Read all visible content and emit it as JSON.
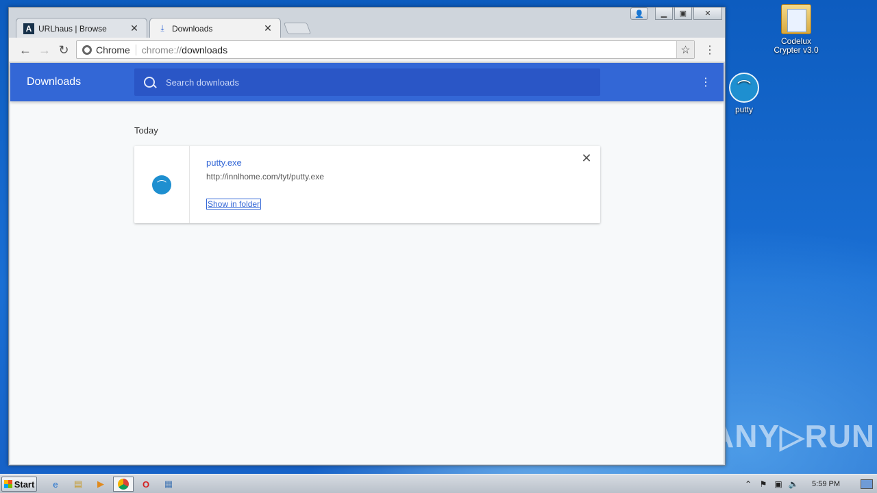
{
  "desktop": {
    "icons": [
      {
        "label": "Codelux\nCrypter v3.0",
        "glyph": "folder-icon"
      },
      {
        "label": "putty",
        "glyph": "putty-icon"
      }
    ],
    "watermark": "ANY▷RUN"
  },
  "browser": {
    "tabs": [
      {
        "title": "URLhaus | Browse",
        "favicon": "A",
        "active": false
      },
      {
        "title": "Downloads",
        "favicon": "⤓",
        "active": true
      }
    ],
    "omnibox": {
      "scheme_label": "Chrome",
      "url_prefix": "chrome://",
      "url_host": "downloads"
    }
  },
  "downloads_page": {
    "title": "Downloads",
    "search_placeholder": "Search downloads",
    "section_date": "Today",
    "items": [
      {
        "file_name": "putty.exe",
        "url": "http://innlhome.com/tyt/putty.exe",
        "action_label": "Show in folder"
      }
    ]
  },
  "taskbar": {
    "start_label": "Start",
    "clock": "5:59 PM"
  },
  "colors": {
    "header_blue": "#3367d6",
    "search_blue": "#2a56c6",
    "link_blue": "#3367d6"
  }
}
